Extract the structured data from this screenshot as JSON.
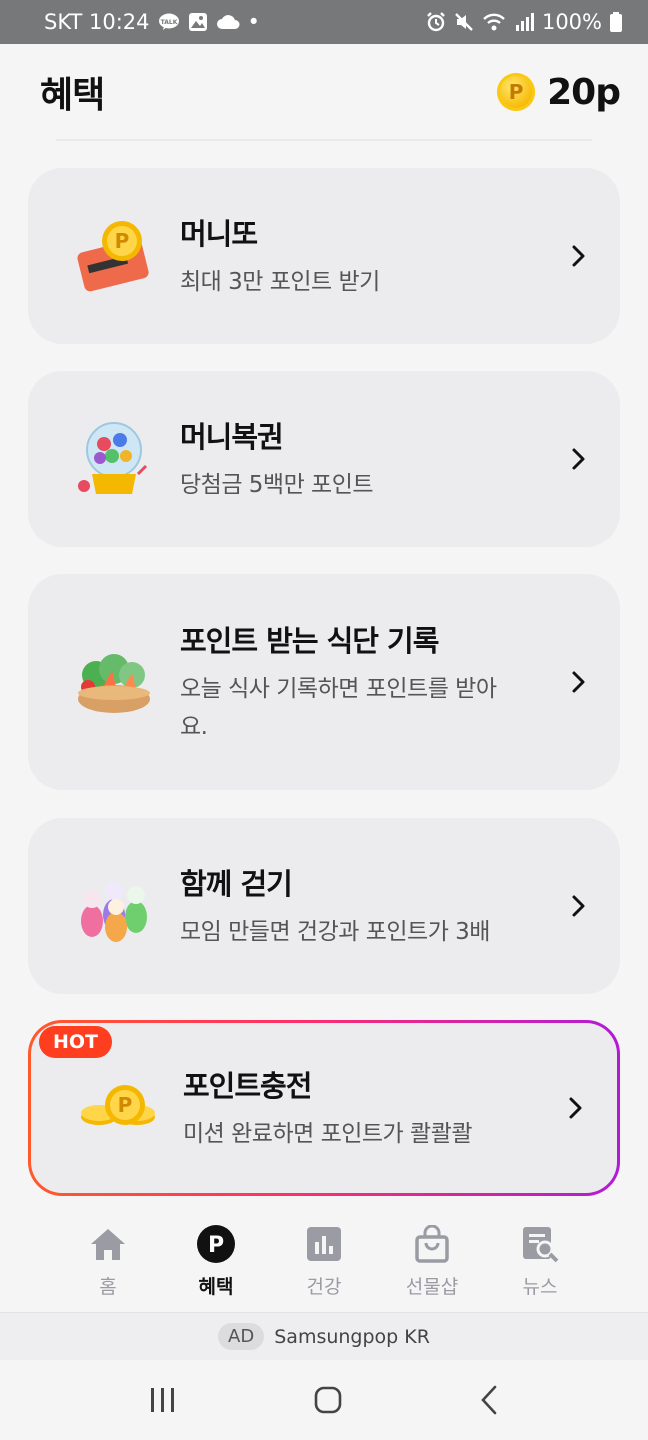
{
  "status_bar": {
    "carrier_time": "SKT 10:24",
    "dot": "•",
    "battery": "100%"
  },
  "header": {
    "title": "혜택",
    "points": "20p",
    "coin_letter": "P"
  },
  "cards": [
    {
      "title": "머니또",
      "subtitle": "최대 3만 포인트 받기",
      "icon": "money-card-icon"
    },
    {
      "title": "머니복권",
      "subtitle": "당첨금 5백만 포인트",
      "icon": "lottery-machine-icon"
    },
    {
      "title": "포인트 받는 식단 기록",
      "subtitle": "오늘 식사 기록하면 포인트를 받아요.",
      "icon": "vegetable-basket-icon"
    },
    {
      "title": "함께 걷기",
      "subtitle": "모임 만들면 건강과 포인트가 3배",
      "icon": "walking-group-icon"
    },
    {
      "title": "포인트충전",
      "subtitle": "미션 완료하면 포인트가 콸콸콸",
      "icon": "coin-stack-icon",
      "badge": "HOT"
    }
  ],
  "bottom_nav": [
    {
      "label": "홈",
      "icon": "home-icon",
      "active": false
    },
    {
      "label": "혜택",
      "icon": "point-icon",
      "active": true
    },
    {
      "label": "건강",
      "icon": "chart-icon",
      "active": false
    },
    {
      "label": "선물샵",
      "icon": "shopping-bag-icon",
      "active": false
    },
    {
      "label": "뉴스",
      "icon": "news-search-icon",
      "active": false
    }
  ],
  "ad": {
    "tag": "AD",
    "text": "Samsungpop KR"
  },
  "colors": {
    "accent_hot": "#ff3d1f",
    "gradient_start": "#ff5a2a",
    "gradient_end": "#b11bd6",
    "coin": "#f5b800"
  }
}
